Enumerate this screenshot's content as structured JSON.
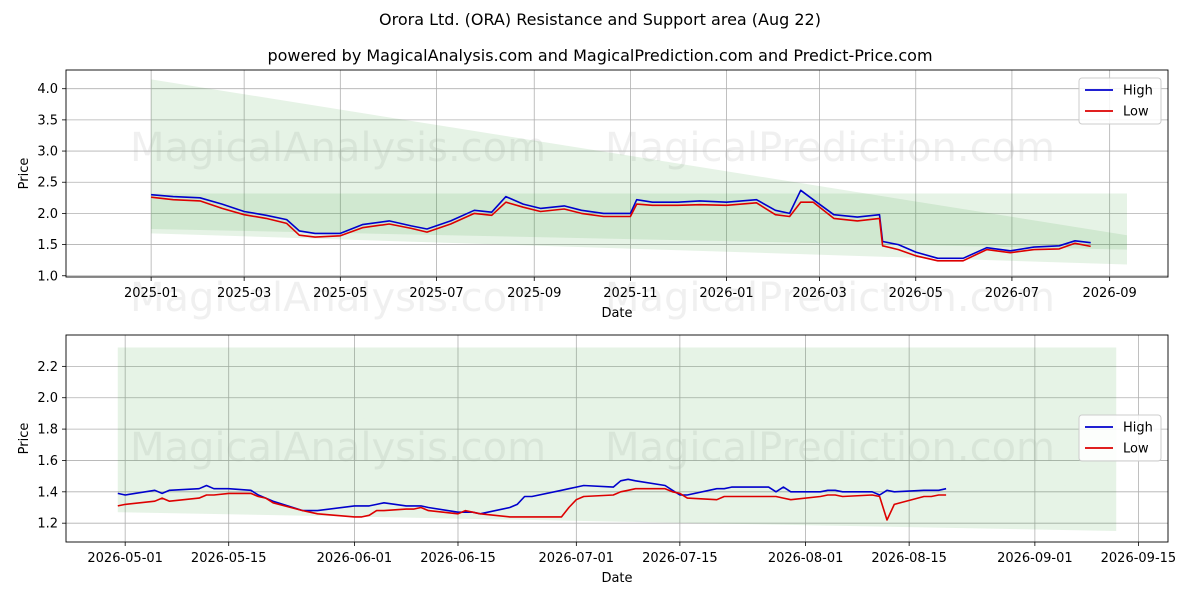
{
  "title": "Orora Ltd. (ORA) Resistance and Support area (Aug 22)",
  "subtitle": "powered by MagicalAnalysis.com and MagicalPrediction.com and Predict-Price.com",
  "watermarks": [
    "MagicalAnalysis.com",
    "MagicalPrediction.com"
  ],
  "colors": {
    "high": "#0000cc",
    "low": "#dd0000",
    "band": "#2e9e2e"
  },
  "chart_data": [
    {
      "type": "line",
      "xlabel": "Date",
      "ylabel": "Price",
      "x_ticks": [
        "2025-01",
        "2025-03",
        "2025-05",
        "2025-07",
        "2025-09",
        "2025-11",
        "2026-01",
        "2026-03",
        "2026-05",
        "2026-07",
        "2026-09"
      ],
      "y_ticks": [
        "1.0",
        "1.5",
        "2.0",
        "2.5",
        "3.0",
        "3.5",
        "4.0"
      ],
      "ylim": [
        0.98,
        4.3
      ],
      "grid": true,
      "legend_position": "top-right",
      "bands": [
        {
          "x": [
            "2025-01-01",
            "2026-09-12"
          ],
          "upper": [
            4.15,
            1.65
          ],
          "lower": [
            1.68,
            1.18
          ]
        },
        {
          "x": [
            "2025-01-01",
            "2026-09-12"
          ],
          "upper": [
            2.32,
            2.32
          ],
          "lower": [
            1.75,
            1.42
          ]
        }
      ],
      "series": [
        {
          "name": "High",
          "x": [
            "2025-01-01",
            "2025-01-15",
            "2025-02-01",
            "2025-02-15",
            "2025-03-01",
            "2025-03-15",
            "2025-03-28",
            "2025-04-05",
            "2025-04-15",
            "2025-05-01",
            "2025-05-15",
            "2025-06-01",
            "2025-06-15",
            "2025-06-25",
            "2025-07-10",
            "2025-07-25",
            "2025-08-05",
            "2025-08-14",
            "2025-08-25",
            "2025-09-05",
            "2025-09-20",
            "2025-10-01",
            "2025-10-15",
            "2025-11-01",
            "2025-11-05",
            "2025-11-15",
            "2025-12-01",
            "2025-12-15",
            "2026-01-01",
            "2026-01-20",
            "2026-02-01",
            "2026-02-10",
            "2026-02-17",
            "2026-02-25",
            "2026-03-10",
            "2026-03-25",
            "2026-04-08",
            "2026-04-10",
            "2026-04-20",
            "2026-05-01",
            "2026-05-15",
            "2026-05-31",
            "2026-06-15",
            "2026-06-30",
            "2026-07-15",
            "2026-07-31",
            "2026-08-10",
            "2026-08-20"
          ],
          "values": [
            2.3,
            2.27,
            2.25,
            2.15,
            2.03,
            1.97,
            1.9,
            1.72,
            1.68,
            1.68,
            1.82,
            1.88,
            1.8,
            1.75,
            1.88,
            2.05,
            2.02,
            2.27,
            2.15,
            2.08,
            2.12,
            2.05,
            2.0,
            2.0,
            2.22,
            2.18,
            2.18,
            2.2,
            2.18,
            2.22,
            2.05,
            2.0,
            2.37,
            2.22,
            1.98,
            1.94,
            1.98,
            1.55,
            1.5,
            1.38,
            1.28,
            1.28,
            1.45,
            1.4,
            1.46,
            1.48,
            1.56,
            1.53
          ]
        },
        {
          "name": "Low",
          "x": [
            "2025-01-01",
            "2025-01-15",
            "2025-02-01",
            "2025-02-15",
            "2025-03-01",
            "2025-03-15",
            "2025-03-28",
            "2025-04-05",
            "2025-04-15",
            "2025-05-01",
            "2025-05-15",
            "2025-06-01",
            "2025-06-15",
            "2025-06-25",
            "2025-07-10",
            "2025-07-25",
            "2025-08-05",
            "2025-08-14",
            "2025-08-25",
            "2025-09-05",
            "2025-09-20",
            "2025-10-01",
            "2025-10-15",
            "2025-11-01",
            "2025-11-05",
            "2025-11-15",
            "2025-12-01",
            "2025-12-15",
            "2026-01-01",
            "2026-01-20",
            "2026-02-01",
            "2026-02-10",
            "2026-02-17",
            "2026-02-25",
            "2026-03-10",
            "2026-03-25",
            "2026-04-08",
            "2026-04-10",
            "2026-04-20",
            "2026-05-01",
            "2026-05-15",
            "2026-05-31",
            "2026-06-15",
            "2026-06-30",
            "2026-07-15",
            "2026-07-31",
            "2026-08-10",
            "2026-08-20"
          ],
          "values": [
            2.26,
            2.22,
            2.2,
            2.08,
            1.98,
            1.92,
            1.84,
            1.65,
            1.62,
            1.64,
            1.77,
            1.83,
            1.76,
            1.7,
            1.83,
            2.0,
            1.97,
            2.18,
            2.1,
            2.03,
            2.07,
            2.0,
            1.95,
            1.95,
            2.15,
            2.13,
            2.13,
            2.14,
            2.13,
            2.17,
            1.98,
            1.95,
            2.18,
            2.18,
            1.92,
            1.88,
            1.92,
            1.48,
            1.42,
            1.32,
            1.24,
            1.24,
            1.42,
            1.37,
            1.42,
            1.43,
            1.52,
            1.47
          ]
        }
      ]
    },
    {
      "type": "line",
      "xlabel": "Date",
      "ylabel": "Price",
      "x_ticks": [
        "2026-05-01",
        "2026-05-15",
        "2026-06-01",
        "2026-06-15",
        "2026-07-01",
        "2026-07-15",
        "2026-08-01",
        "2026-08-15",
        "2026-09-01",
        "2026-09-15"
      ],
      "y_ticks": [
        "1.2",
        "1.4",
        "1.6",
        "1.8",
        "2.0",
        "2.2"
      ],
      "ylim": [
        1.08,
        2.4
      ],
      "grid": true,
      "legend_position": "center-right",
      "bands": [
        {
          "x": [
            "2026-04-30",
            "2026-09-12"
          ],
          "upper": [
            2.02,
            1.41
          ],
          "lower": [
            1.27,
            1.15
          ]
        },
        {
          "x": [
            "2026-04-30",
            "2026-09-12"
          ],
          "upper": [
            2.32,
            2.32
          ],
          "lower": [
            2.02,
            1.41
          ]
        }
      ],
      "series": [
        {
          "name": "High",
          "x": [
            "2026-04-30",
            "2026-05-01",
            "2026-05-05",
            "2026-05-06",
            "2026-05-07",
            "2026-05-11",
            "2026-05-12",
            "2026-05-13",
            "2026-05-15",
            "2026-05-18",
            "2026-05-19",
            "2026-05-20",
            "2026-05-21",
            "2026-05-25",
            "2026-05-26",
            "2026-05-27",
            "2026-06-01",
            "2026-06-02",
            "2026-06-03",
            "2026-06-04",
            "2026-06-05",
            "2026-06-08",
            "2026-06-09",
            "2026-06-10",
            "2026-06-11",
            "2026-06-15",
            "2026-06-16",
            "2026-06-17",
            "2026-06-18",
            "2026-06-22",
            "2026-06-23",
            "2026-06-24",
            "2026-06-25",
            "2026-06-29",
            "2026-06-30",
            "2026-07-01",
            "2026-07-02",
            "2026-07-06",
            "2026-07-07",
            "2026-07-08",
            "2026-07-09",
            "2026-07-13",
            "2026-07-14",
            "2026-07-15",
            "2026-07-16",
            "2026-07-20",
            "2026-07-21",
            "2026-07-22",
            "2026-07-23",
            "2026-07-27",
            "2026-07-28",
            "2026-07-29",
            "2026-07-30",
            "2026-08-03",
            "2026-08-04",
            "2026-08-05",
            "2026-08-06",
            "2026-08-10",
            "2026-08-11",
            "2026-08-12",
            "2026-08-13",
            "2026-08-17",
            "2026-08-18",
            "2026-08-19",
            "2026-08-20"
          ],
          "values": [
            1.39,
            1.38,
            1.41,
            1.39,
            1.41,
            1.42,
            1.44,
            1.42,
            1.42,
            1.41,
            1.38,
            1.36,
            1.34,
            1.28,
            1.28,
            1.28,
            1.31,
            1.31,
            1.31,
            1.32,
            1.33,
            1.31,
            1.31,
            1.31,
            1.3,
            1.27,
            1.27,
            1.27,
            1.26,
            1.3,
            1.32,
            1.37,
            1.37,
            1.41,
            1.42,
            1.43,
            1.44,
            1.43,
            1.47,
            1.48,
            1.47,
            1.44,
            1.41,
            1.38,
            1.38,
            1.42,
            1.42,
            1.43,
            1.43,
            1.43,
            1.4,
            1.43,
            1.4,
            1.4,
            1.41,
            1.41,
            1.4,
            1.4,
            1.38,
            1.41,
            1.4,
            1.41,
            1.41,
            1.41,
            1.42
          ]
        },
        {
          "name": "Low",
          "x": [
            "2026-04-30",
            "2026-05-01",
            "2026-05-05",
            "2026-05-06",
            "2026-05-07",
            "2026-05-11",
            "2026-05-12",
            "2026-05-13",
            "2026-05-15",
            "2026-05-18",
            "2026-05-19",
            "2026-05-20",
            "2026-05-21",
            "2026-05-25",
            "2026-05-26",
            "2026-05-27",
            "2026-06-01",
            "2026-06-02",
            "2026-06-03",
            "2026-06-04",
            "2026-06-05",
            "2026-06-08",
            "2026-06-09",
            "2026-06-10",
            "2026-06-11",
            "2026-06-15",
            "2026-06-16",
            "2026-06-17",
            "2026-06-18",
            "2026-06-22",
            "2026-06-23",
            "2026-06-24",
            "2026-06-25",
            "2026-06-29",
            "2026-06-30",
            "2026-07-01",
            "2026-07-02",
            "2026-07-06",
            "2026-07-07",
            "2026-07-08",
            "2026-07-09",
            "2026-07-13",
            "2026-07-14",
            "2026-07-15",
            "2026-07-16",
            "2026-07-20",
            "2026-07-21",
            "2026-07-22",
            "2026-07-23",
            "2026-07-27",
            "2026-07-28",
            "2026-07-29",
            "2026-07-30",
            "2026-08-03",
            "2026-08-04",
            "2026-08-05",
            "2026-08-06",
            "2026-08-10",
            "2026-08-11",
            "2026-08-12",
            "2026-08-13",
            "2026-08-17",
            "2026-08-18",
            "2026-08-19",
            "2026-08-20"
          ],
          "values": [
            1.31,
            1.32,
            1.34,
            1.36,
            1.34,
            1.36,
            1.38,
            1.38,
            1.39,
            1.39,
            1.37,
            1.36,
            1.33,
            1.28,
            1.27,
            1.26,
            1.24,
            1.24,
            1.25,
            1.28,
            1.28,
            1.29,
            1.29,
            1.3,
            1.28,
            1.26,
            1.28,
            1.27,
            1.26,
            1.24,
            1.24,
            1.24,
            1.24,
            1.24,
            1.3,
            1.35,
            1.37,
            1.38,
            1.4,
            1.41,
            1.42,
            1.42,
            1.4,
            1.39,
            1.36,
            1.35,
            1.37,
            1.37,
            1.37,
            1.37,
            1.37,
            1.36,
            1.35,
            1.37,
            1.38,
            1.38,
            1.37,
            1.38,
            1.37,
            1.22,
            1.32,
            1.37,
            1.37,
            1.38,
            1.38
          ]
        }
      ]
    }
  ]
}
